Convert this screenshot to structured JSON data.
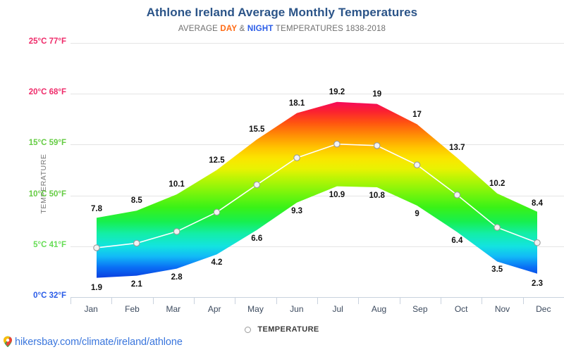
{
  "header": {
    "title": "Athlone Ireland Average Monthly Temperatures",
    "subtitle_pre": "AVERAGE ",
    "subtitle_day": "DAY",
    "subtitle_amp": " & ",
    "subtitle_night": "NIGHT",
    "subtitle_post": " TEMPERATURES 1838-2018"
  },
  "legend": {
    "marker_icon": "circle-outline-icon",
    "label": "TEMPERATURE"
  },
  "footer": {
    "pin_icon": "map-pin-icon",
    "link": "hikersbay.com/climate/ireland/athlone"
  },
  "colors": {
    "title": "#2b5488",
    "subtitle": "#6f6f6f",
    "day": "#ff6a13",
    "night": "#2a5ce8",
    "link": "#3a76dd",
    "grid": "#e4e4e4",
    "axis_line": "#c9d2de",
    "tick_25": "#ef2b6a",
    "tick_20": "#ef2b6a",
    "tick_15": "#66cc44",
    "tick_10": "#66cc44",
    "tick_5": "#66dd55",
    "tick_0": "#2a5ce8",
    "data_label": "#111111",
    "month_label": "#3c4a5e",
    "line": "#ffffff",
    "marker_fill": "#f2f2f2",
    "marker_stroke": "#9a9a9a"
  },
  "chart_data": {
    "type": "area",
    "title": "Athlone Ireland Average Monthly Temperatures",
    "subtitle": "AVERAGE DAY & NIGHT TEMPERATURES 1838-2018",
    "xlabel": "",
    "ylabel": "TEMPERATURE",
    "grid": true,
    "legend_position": "bottom",
    "ylim": [
      0,
      25
    ],
    "yticks": [
      0,
      5,
      10,
      15,
      20,
      25
    ],
    "ytick_labels": [
      "0°C 32°F",
      "5°C 41°F",
      "10°C 50°F",
      "15°C 59°F",
      "20°C 68°F",
      "25°C 77°F"
    ],
    "categories": [
      "Jan",
      "Feb",
      "Mar",
      "Apr",
      "May",
      "Jun",
      "Jul",
      "Aug",
      "Sep",
      "Oct",
      "Nov",
      "Dec"
    ],
    "series": [
      {
        "name": "DAY",
        "values": [
          7.8,
          8.5,
          10.1,
          12.5,
          15.5,
          18.1,
          19.2,
          19,
          17,
          13.7,
          10.2,
          8.4
        ]
      },
      {
        "name": "NIGHT",
        "values": [
          1.9,
          2.1,
          2.8,
          4.2,
          6.6,
          9.3,
          10.9,
          10.8,
          9,
          6.4,
          3.5,
          2.3
        ]
      },
      {
        "name": "TEMPERATURE",
        "values": [
          4.85,
          5.3,
          6.45,
          8.35,
          11.05,
          13.7,
          15.05,
          14.9,
          13.0,
          10.05,
          6.85,
          5.35
        ]
      }
    ]
  }
}
